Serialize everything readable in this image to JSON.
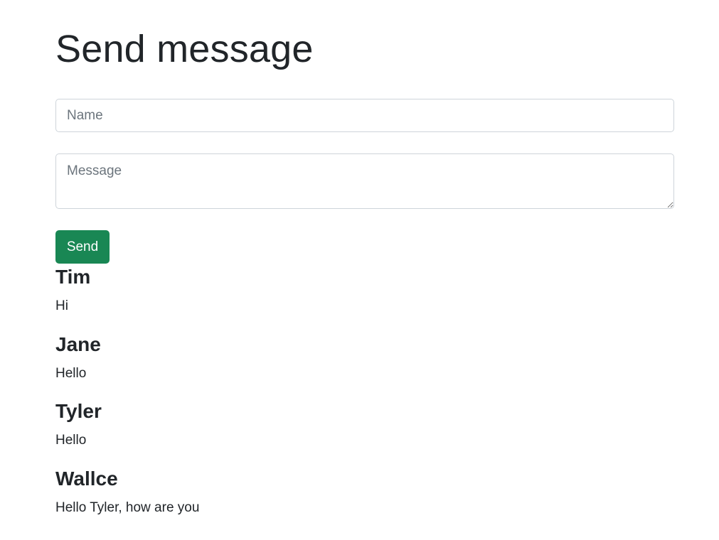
{
  "form": {
    "title": "Send message",
    "name_placeholder": "Name",
    "name_value": "",
    "message_placeholder": "Message",
    "message_value": "",
    "send_label": "Send"
  },
  "messages": [
    {
      "author": "Tim",
      "text": "Hi"
    },
    {
      "author": "Jane",
      "text": "Hello"
    },
    {
      "author": "Tyler",
      "text": "Hello"
    },
    {
      "author": "Wallce",
      "text": "Hello Tyler, how are you"
    }
  ],
  "colors": {
    "send_button_bg": "#198754",
    "text": "#212529",
    "placeholder": "#6c757d",
    "field_border": "#ced4da"
  }
}
